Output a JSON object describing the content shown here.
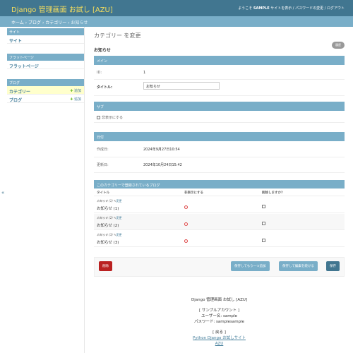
{
  "header": {
    "brand": "Django 管理画面 お試し [AZU]",
    "welcome": "ようこそ",
    "username": "SAMPLE",
    "view_site": "サイトを表示",
    "change_password": "パスワードの変更",
    "logout": "ログアウト"
  },
  "breadcrumbs": {
    "home": "ホーム",
    "app": "ブログ",
    "model": "カテゴリー",
    "current": "お知らせ"
  },
  "sidebar": {
    "modules": [
      {
        "caption": "サイト",
        "items": [
          {
            "label": "サイト",
            "add": ""
          }
        ]
      },
      {
        "caption": "フラットページ",
        "items": [
          {
            "label": "フラットページ",
            "add": ""
          }
        ]
      },
      {
        "caption": "ブログ",
        "items": [
          {
            "label": "カテゴリー",
            "add": "追加"
          },
          {
            "label": "ブログ",
            "add": "追加"
          }
        ]
      }
    ],
    "collapse_toggle": "«"
  },
  "content": {
    "title": "カテゴリー を変更",
    "object_name": "お知らせ",
    "history_button": "履歴",
    "fieldsets": {
      "main": {
        "caption": "メイン",
        "id_label": "ID:",
        "id_value": "1",
        "title_label": "タイトル:",
        "title_value": "お知らせ"
      },
      "sub": {
        "caption": "サブ",
        "hidden_label": "非表示にする"
      },
      "dates": {
        "caption": "日付",
        "created_label": "作成日:",
        "created_value": "2024年9月27日10:54",
        "updated_label": "更新日:",
        "updated_value": "2024年10月24日15:42"
      }
    },
    "inline": {
      "caption": "このカテゴリーで登録されているブログ",
      "headers": {
        "title": "タイトル",
        "hidden": "非表示にする",
        "delete": "削除しますか?"
      },
      "rows": [
        {
          "original": "お知らせ (1)",
          "change": "変更",
          "value": "お知らせ (1)"
        },
        {
          "original": "お知らせ (2)",
          "change": "変更",
          "value": "お知らせ (2)"
        },
        {
          "original": "お知らせ (3)",
          "change": "変更",
          "value": "お知らせ (3)"
        }
      ]
    },
    "buttons": {
      "delete": "削除",
      "save_add_another": "保存してもう一つ追加",
      "save_continue": "保存して編集を続ける",
      "save": "保存"
    }
  },
  "footer": {
    "line1": "Django 管理画面 お試し [AZU]",
    "line2": "[ サンプルアカウント ]",
    "line3": "ユーザー名: sample",
    "line4": "パスワード: samplesample",
    "line5": "[ 戻る ]",
    "link1": "Python Django お試しサイト",
    "link2": "AZU"
  },
  "colors": {
    "header_bg": "#417690",
    "brand_text": "#f5dd5d",
    "caption_bg": "#79aec8",
    "delete_red": "#ba2121"
  }
}
